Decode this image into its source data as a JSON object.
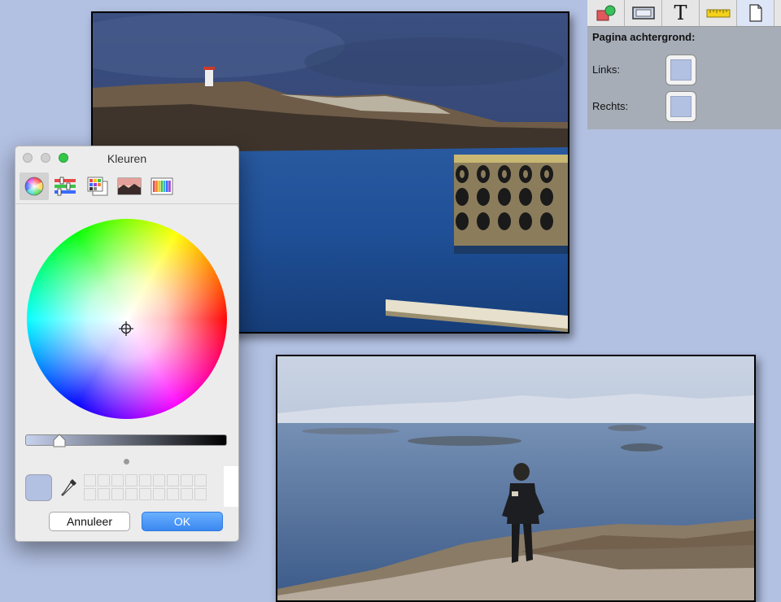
{
  "inspector": {
    "tabs": [
      {
        "icon": "shapes-icon"
      },
      {
        "icon": "rectangle-frame-icon"
      },
      {
        "icon": "text-icon",
        "glyph": "T"
      },
      {
        "icon": "ruler-icon"
      },
      {
        "icon": "page-icon",
        "active": true
      }
    ],
    "heading": "Pagina achtergrond:",
    "left_label": "Links:",
    "right_label": "Rechts:",
    "swatch_color": "#b2c0e2"
  },
  "color_panel": {
    "title": "Kleuren",
    "modes": [
      "color-wheel-icon",
      "color-sliders-icon",
      "color-palettes-icon",
      "image-palettes-icon",
      "crayons-icon"
    ],
    "active_mode": 0,
    "brightness": 0.14,
    "current_color": "#b2c0e2",
    "cancel_label": "Annuleer",
    "ok_label": "OK"
  },
  "colors": {
    "background": "#b2c0e2",
    "accent": "#3f8ff0"
  }
}
